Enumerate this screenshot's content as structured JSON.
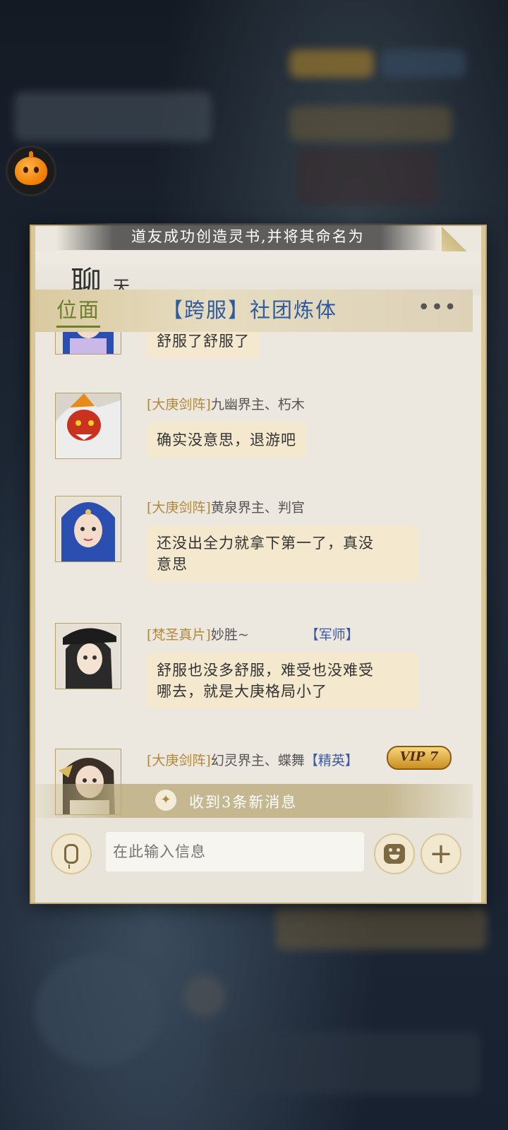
{
  "ticker": {
    "text": "道友成功创造灵书,并将其命名为"
  },
  "panel": {
    "title_big": "聊",
    "title_small": "天",
    "tab_active": "位面",
    "tab_title": "【跨服】社团炼体",
    "more_label": "•••"
  },
  "messages": [
    {
      "bubble": "舒服了舒服了"
    },
    {
      "guild": "[大庚剑阵]",
      "name": "九幽界主、朽木",
      "bubble": "确实没意思，退游吧"
    },
    {
      "guild": "[大庚剑阵]",
      "name": "黄泉界主、判官",
      "bubble_line1": "还没出全力就拿下第一了，真没",
      "bubble_line2": "意思"
    },
    {
      "guild": "[梵圣真片]",
      "name": "妙胜~",
      "role": "【军师】",
      "bubble_line1": "舒服也没多舒服，难受也没难受",
      "bubble_line2": "哪去，就是大庚格局小了"
    },
    {
      "guild": "[大庚剑阵]",
      "name": "幻灵界主、蝶舞",
      "role": "【精英】",
      "vip": "VIP 7"
    }
  ],
  "new_messages": {
    "text": "收到3条新消息"
  },
  "input": {
    "placeholder": "在此输入信息"
  },
  "icons": {
    "floating": "pumpkin-icon",
    "voice": "mic-icon",
    "emoji": "emoji-icon",
    "add": "plus-icon"
  }
}
